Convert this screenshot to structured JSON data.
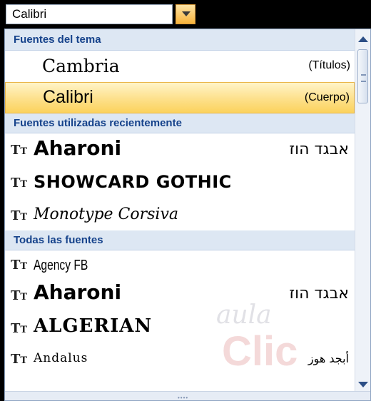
{
  "combo": {
    "value": "Calibri"
  },
  "sections": {
    "theme_header": "Fuentes del tema",
    "recent_header": "Fuentes utilizadas recientemente",
    "all_header": "Todas las fuentes"
  },
  "theme_fonts": [
    {
      "name": "Cambria",
      "tag": "(Títulos)"
    },
    {
      "name": "Calibri",
      "tag": "(Cuerpo)"
    }
  ],
  "recent_fonts": [
    {
      "name": "Aharoni",
      "sample": "אבגד הוז"
    },
    {
      "name": "SHOWCARD GOTHIC",
      "sample": ""
    },
    {
      "name": "Monotype Corsiva",
      "sample": ""
    }
  ],
  "all_fonts": [
    {
      "name": "Agency FB",
      "sample": ""
    },
    {
      "name": "Aharoni",
      "sample": "אבגד הוז"
    },
    {
      "name": "ALGERIAN",
      "sample": ""
    },
    {
      "name": "Andalus",
      "sample": "أبجد هوز"
    }
  ],
  "watermark": {
    "line1": "aula",
    "line2": "Clic"
  },
  "colors": {
    "header_bg": "#dde7f3",
    "header_text": "#15428b",
    "selected_bg": "#fde08a"
  }
}
